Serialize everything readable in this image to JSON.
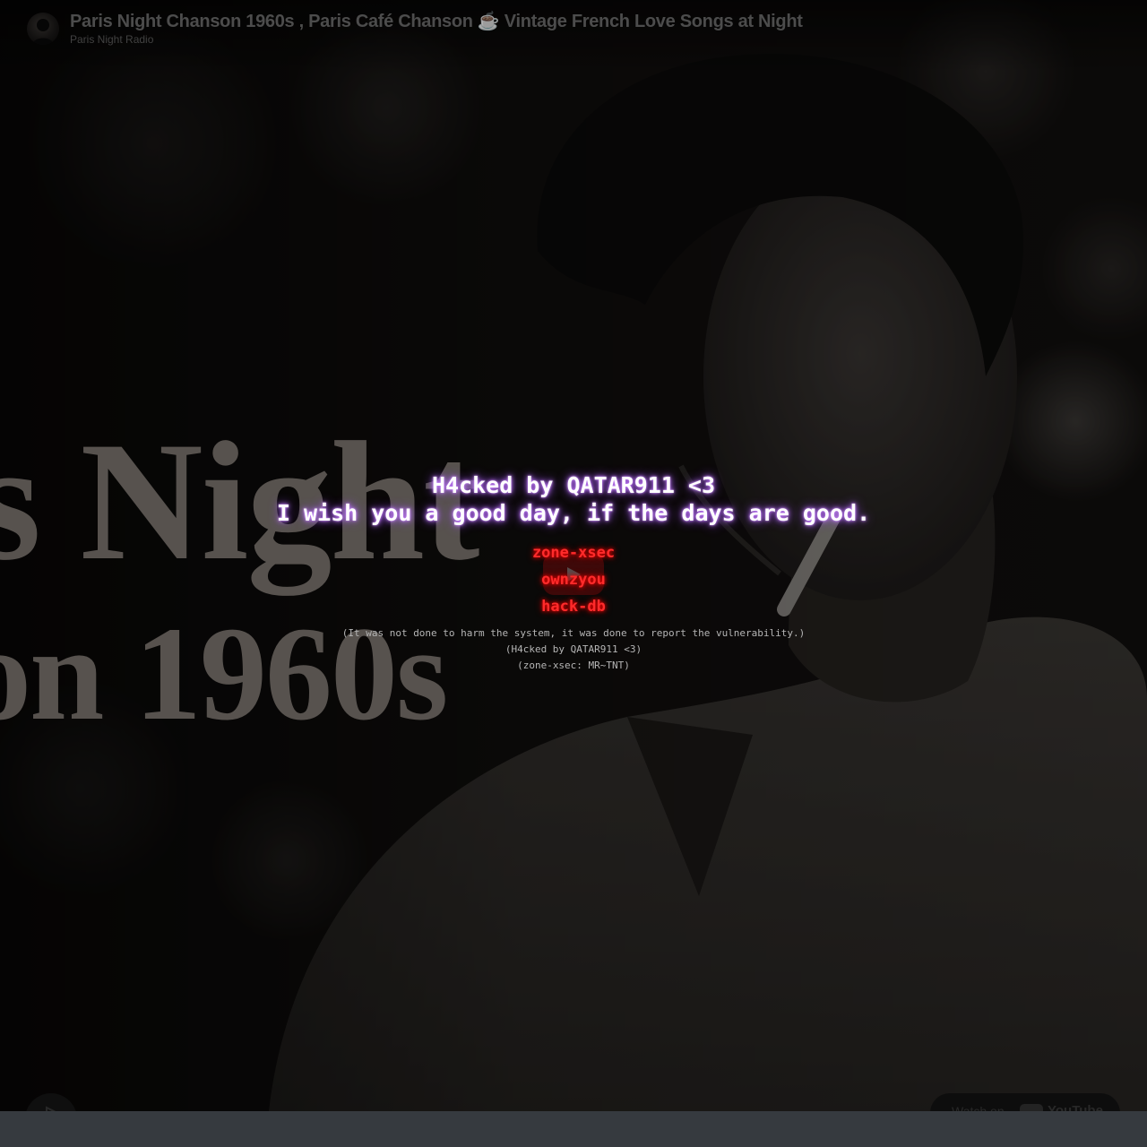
{
  "video": {
    "title": "Paris Night Chanson 1960s , Paris Café Chanson ☕ Vintage French Love Songs at Night",
    "channel": "Paris Night Radio",
    "thumbnail_text_line1": "s Night",
    "thumbnail_text_line2": "on 1960s",
    "watch_on_label": "Watch on",
    "youtube_logo_text": "YouTube"
  },
  "overlay": {
    "headline": "H4cked by QATAR911 <3",
    "subline": "I wish you a good day, if the days are good.",
    "tags": [
      "zone-xsec",
      "ownzyou",
      "hack-db"
    ],
    "notes": [
      "(It was not done to harm the system, it was done to report the vulnerability.)",
      "(H4cked by QATAR911 <3)",
      "(zone-xsec: MR~TNT)"
    ]
  },
  "colors": {
    "headline_glow": "#c77dff",
    "tag_red": "#ff2b2b",
    "footer": "#363a3f"
  },
  "icons": {
    "play": "play-icon",
    "share": "share-icon",
    "youtube": "youtube-logo-icon"
  }
}
